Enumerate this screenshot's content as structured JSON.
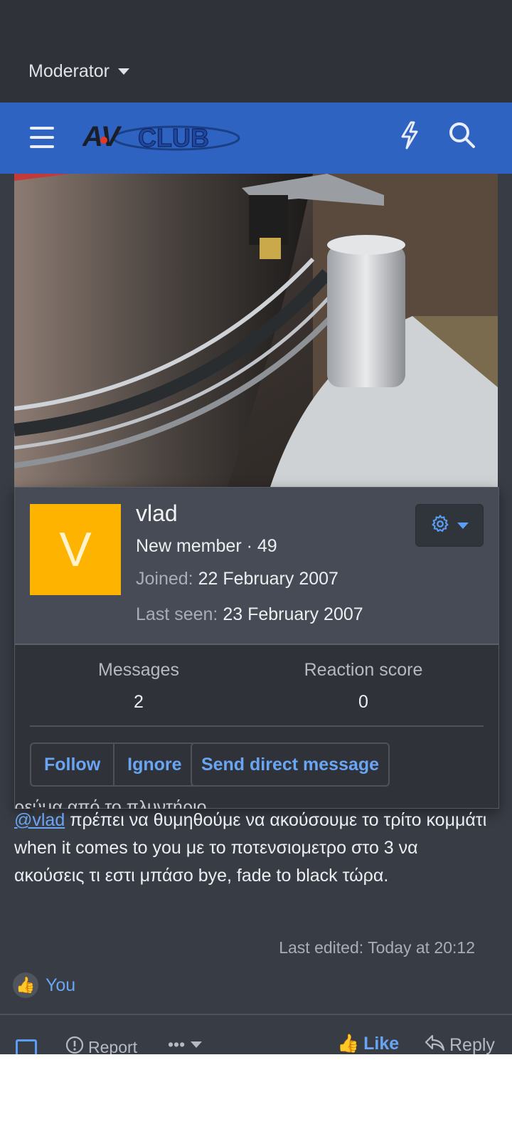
{
  "header": {
    "role_label": "Moderator",
    "site_logo_text": "AVCLUB"
  },
  "profile_card": {
    "avatar_letter": "V",
    "username": "vlad",
    "user_title": "New member · 49",
    "joined_label": "Joined:",
    "joined_value": "22 February 2007",
    "last_seen_label": "Last seen:",
    "last_seen_value": "23 February 2007",
    "stats": [
      {
        "label": "Messages",
        "value": "2"
      },
      {
        "label": "Reaction score",
        "value": "0"
      }
    ],
    "buttons": {
      "follow": "Follow",
      "ignore": "Ignore",
      "send_dm": "Send direct message"
    },
    "colors": {
      "avatar_bg": "#fdb300",
      "accent": "#6aa5f4"
    }
  },
  "post": {
    "cut_off_line": "ρεύμα από το πλυντήριο.",
    "mention": "@vlad",
    "body": " πρέπει να θυμηθούμε να ακούσουμε το τρίτο κομμάτι when it comes to you με το ποτενσιομετρο στο 3 να ακούσεις τι εστι μπάσο bye, fade to black τώρα.",
    "last_edited": "Last edited: Today at 20:12",
    "reaction_you": "You"
  },
  "actions": {
    "report": "Report",
    "more": "•••",
    "like": "Like",
    "reply": "Reply"
  },
  "icons": [
    "menu-icon",
    "lightning-icon",
    "search-icon",
    "gear-icon",
    "thumbs-up-icon",
    "report-icon",
    "reply-icon"
  ]
}
